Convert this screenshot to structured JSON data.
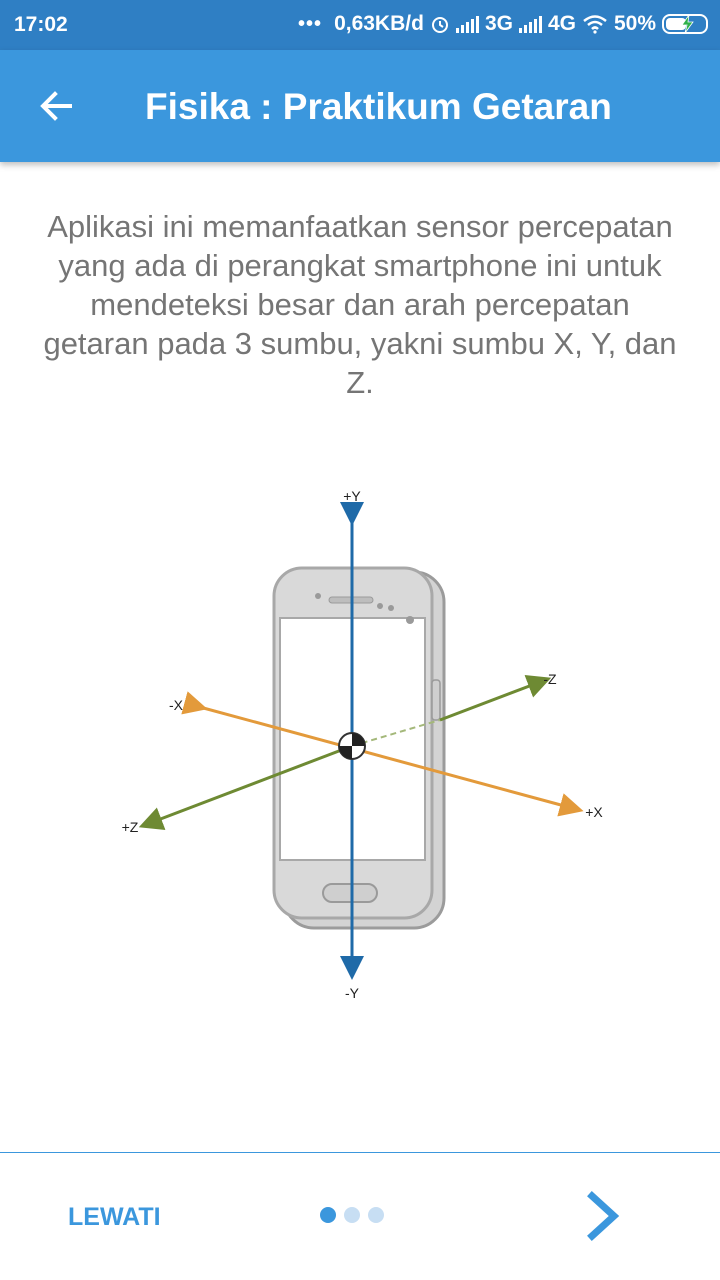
{
  "status_bar": {
    "time": "17:02",
    "dots": "•••",
    "data_rate": "0,63KB/d",
    "network_3g": "3G",
    "network_4g": "4G",
    "battery": "50%"
  },
  "app_bar": {
    "title": "Fisika : Praktikum Getaran",
    "back_icon": "arrow-left-icon"
  },
  "intro": {
    "text": "Aplikasi ini memanfaatkan sensor percepatan yang ada di perangkat smartphone ini untuk mendeteksi besar dan arah percepatan getaran pada 3 sumbu, yakni sumbu X, Y, dan Z."
  },
  "diagram": {
    "labels": {
      "y_pos": "+Y",
      "y_neg": "-Y",
      "x_pos": "+X",
      "x_neg": "-X",
      "z_pos": "+Z",
      "z_neg": "-Z"
    },
    "colors": {
      "y_axis": "#1f6aa8",
      "x_axis": "#e39a3b",
      "z_axis": "#6e8a33"
    }
  },
  "footer": {
    "skip_label": "LEWATI",
    "page_count": 3,
    "active_page": 1,
    "next_icon": "chevron-right-icon"
  }
}
